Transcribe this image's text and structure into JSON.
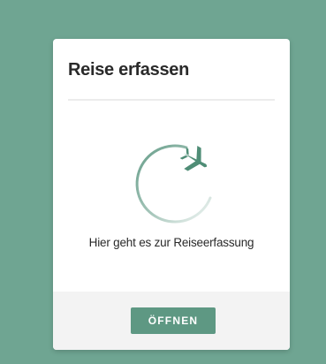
{
  "card": {
    "title": "Reise erfassen",
    "illustration_icon": "plane-circle-icon",
    "subtitle": "Hier geht es zur Reiseerfassung",
    "button_label": "ÖFFNEN"
  },
  "colors": {
    "background": "#6fa592",
    "accent": "#5e9883",
    "card": "#ffffff",
    "footer": "#f3f3f3"
  }
}
